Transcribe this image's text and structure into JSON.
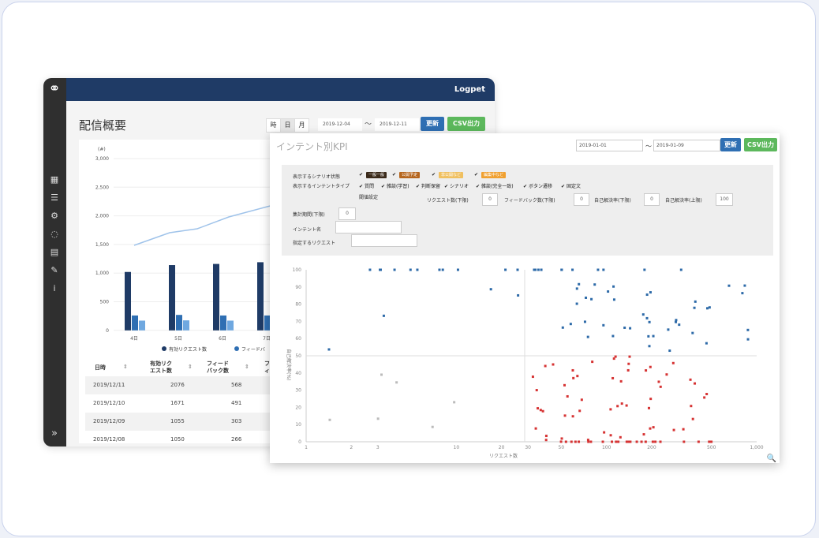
{
  "back": {
    "brand": "Logpet",
    "page_title": "配信概要",
    "period_tabs": [
      "時",
      "日",
      "月"
    ],
    "active_tab": 1,
    "date_from": "2019-12-04",
    "date_sep": "〜",
    "date_to": "2019-12-11",
    "update_label": "更新",
    "csv_label": "CSV出力",
    "sidebar_icons": [
      "chart-icon",
      "list-icon",
      "users-icon",
      "chat-icon",
      "inbox-icon",
      "wrench-icon",
      "info-icon"
    ],
    "expand_glyph": "»",
    "chart": {
      "unit": "(#)",
      "yticks": [
        "3,000",
        "2,500",
        "2,000",
        "1,500",
        "1,000",
        "500",
        "0"
      ],
      "categories": [
        "4日",
        "5日",
        "6日",
        "7日"
      ],
      "legend": [
        "有効リクエスト数",
        "フィードバ"
      ]
    },
    "table": {
      "headers": [
        "日時",
        "有効リク\nエスト数",
        "フィード\nバック数",
        "フ\nィ"
      ],
      "rows": [
        [
          "2019/12/11",
          "2076",
          "568"
        ],
        [
          "2019/12/10",
          "1671",
          "491"
        ],
        [
          "2019/12/09",
          "1055",
          "303"
        ],
        [
          "2019/12/08",
          "1050",
          "266"
        ]
      ]
    }
  },
  "front": {
    "title": "インテント別KPI",
    "date_from": "2019-01-01",
    "date_sep": "〜",
    "date_to": "2019-01-09",
    "update_label": "更新",
    "csv_label": "CSV出力",
    "filters": {
      "scenario_label": "表示するシナリオ状態",
      "scenario_tags": [
        "一般一般",
        "公開予定",
        "非公開など",
        "編集中など"
      ],
      "intent_type_label": "表示するインテントタイプ",
      "intent_types": [
        "質問",
        "雑談(学習)",
        "判断保留",
        "シナリオ",
        "雑談(完全一致)",
        "ボタン遷移",
        "固定文"
      ],
      "threshold_label": "閾値設定",
      "req_min_label": "リクエスト数(下限)",
      "req_min": "0",
      "fb_min_label": "フィードバック数(下限)",
      "fb_min": "0",
      "self_min_label": "自己解決率(下限)",
      "self_min": "0",
      "self_max_label": "自己解決率(上限)",
      "self_max": "100",
      "period_label": "集計期間(下限)",
      "period": "0",
      "intent_name_label": "インテント名",
      "intent_name": "",
      "req_text_label": "指定するリクエスト",
      "req_text": ""
    },
    "scatter": {
      "yticks": [
        "100",
        "90",
        "80",
        "70",
        "60",
        "50",
        "40",
        "30",
        "20",
        "10",
        "0"
      ],
      "xticks": [
        "1",
        "2",
        "3",
        "10",
        "20",
        "30",
        "50",
        "100",
        "200",
        "500",
        "1,000"
      ],
      "xlabel": "リクエスト数",
      "ylabel": "自己解決率(%)"
    }
  },
  "colors": {
    "header_navy": "#1f3b66",
    "bar_dark": "#1f3b66",
    "bar_mid": "#2f6fb3",
    "bar_light": "#6fa8e0",
    "line": "#9fc3ea",
    "dot_blue": "#2d6aa8",
    "dot_red": "#d63333",
    "dot_gray": "#bbbbbb",
    "btn_blue": "#2f6fb3",
    "btn_green": "#5cb85c"
  }
}
